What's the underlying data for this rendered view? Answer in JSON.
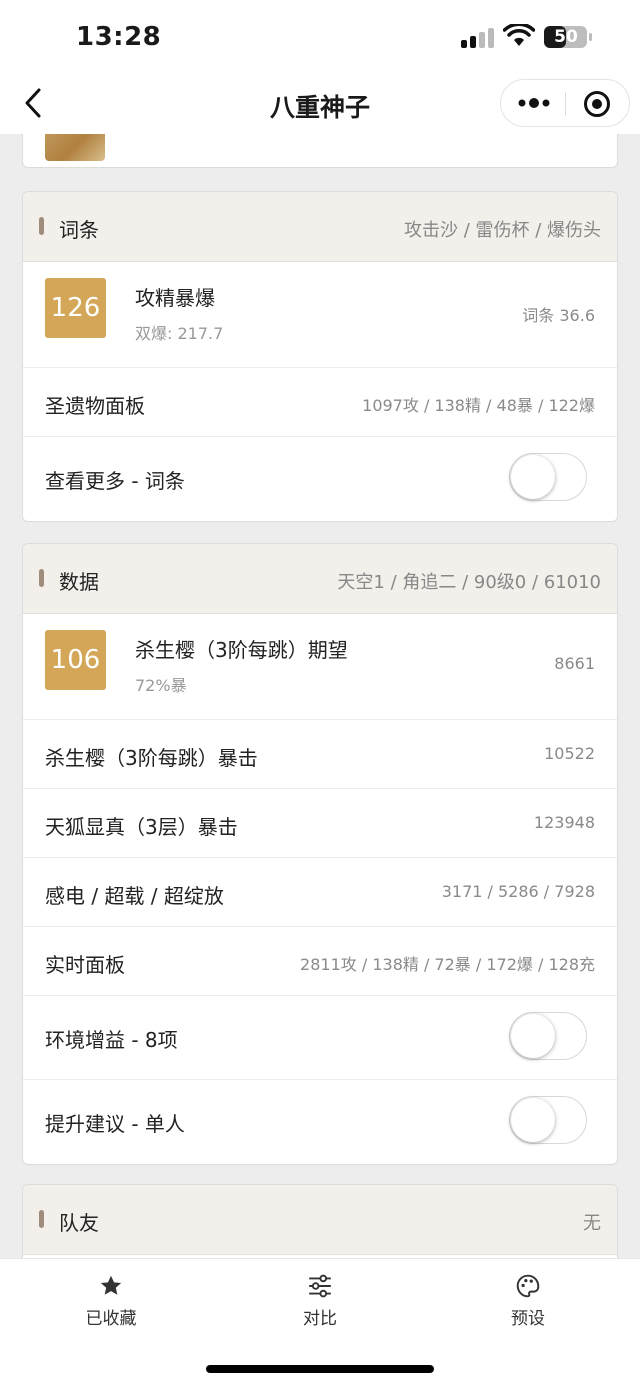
{
  "status_bar": {
    "time": "13:28",
    "battery": "50"
  },
  "nav": {
    "title": "八重神子"
  },
  "affix_card": {
    "title": "词条",
    "subtitle": "攻击沙 / 雷伤杯 / 爆伤头",
    "featured": {
      "score": "126",
      "title": "攻精暴爆",
      "sub": "双爆: 217.7",
      "value": "词条 36.6"
    },
    "rows": [
      {
        "label": "圣遗物面板",
        "value": "1097攻 / 138精 / 48暴 / 122爆"
      }
    ],
    "toggle_label": "查看更多 - 词条"
  },
  "data_card": {
    "title": "数据",
    "subtitle": "天空1 / 角追二 / 90级0 / 61010",
    "featured": {
      "score": "106",
      "title": "杀生樱（3阶每跳）期望",
      "sub": "72%暴",
      "value": "8661"
    },
    "rows": [
      {
        "label": "杀生樱（3阶每跳）暴击",
        "value": "10522"
      },
      {
        "label": "天狐显真（3层）暴击",
        "value": "123948"
      },
      {
        "label": "感电 / 超载 / 超绽放",
        "value": "3171 / 5286 / 7928"
      },
      {
        "label": "实时面板",
        "value": "2811攻 / 138精 / 72暴 / 172爆 / 128充"
      }
    ],
    "toggles": [
      "环境增益 - 8项",
      "提升建议 - 单人"
    ]
  },
  "team_card": {
    "title": "队友",
    "subtitle": "无"
  },
  "tabbar": {
    "items": [
      "已收藏",
      "对比",
      "预设"
    ]
  },
  "colors": {
    "score_badge": "#d4a658",
    "section_header": "#f3efeb",
    "section_bar": "#a08c7b"
  }
}
